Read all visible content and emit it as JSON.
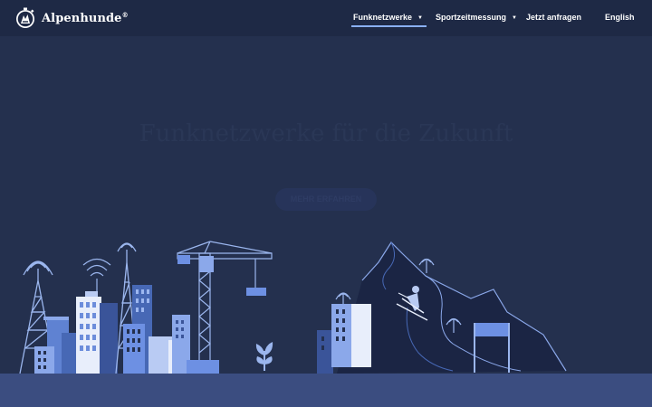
{
  "brand": {
    "name": "Alpenhunde",
    "mark": "®",
    "logo_icon": "clock-dog-logo-icon"
  },
  "nav": {
    "items": [
      {
        "label": "Funknetzwerke",
        "caret": "▼",
        "active": true
      },
      {
        "label": "Sportzeitmessung",
        "caret": "▼",
        "active": false
      },
      {
        "label": "Jetzt anfragen"
      },
      {
        "label": "English"
      }
    ]
  },
  "hero": {
    "title": "Funknetzwerke für die Zukunft",
    "subtitle": "",
    "button_label": "MEHR ERFAHREN"
  },
  "illustration": {
    "left_scene": "city-with-radio-towers-and-crane",
    "right_scene": "mountain-with-skier-and-radio-antennas"
  },
  "colors": {
    "background": "#24304e",
    "nav_background": "#1e2945",
    "accent": "#8ab0f5",
    "ground": "#3b4d80"
  }
}
